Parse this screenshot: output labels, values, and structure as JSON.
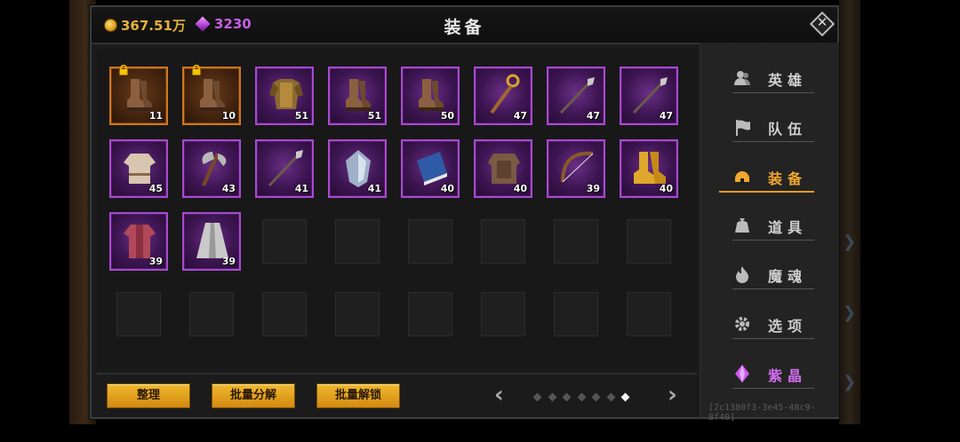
{
  "currency": {
    "gold": "367.51万",
    "gems": "3230"
  },
  "title": "装备",
  "inventory": [
    {
      "level": "11",
      "rarity": "orange",
      "locked": true,
      "icon": "boots-icon"
    },
    {
      "level": "10",
      "rarity": "orange",
      "locked": true,
      "icon": "boots-icon"
    },
    {
      "level": "51",
      "rarity": "purple",
      "locked": false,
      "icon": "armor-icon"
    },
    {
      "level": "51",
      "rarity": "purple",
      "locked": false,
      "icon": "boots-icon"
    },
    {
      "level": "50",
      "rarity": "purple",
      "locked": false,
      "icon": "boots-icon"
    },
    {
      "level": "47",
      "rarity": "purple",
      "locked": false,
      "icon": "staff-icon"
    },
    {
      "level": "47",
      "rarity": "purple",
      "locked": false,
      "icon": "spear-icon"
    },
    {
      "level": "47",
      "rarity": "purple",
      "locked": false,
      "icon": "spear-icon"
    },
    {
      "level": "45",
      "rarity": "purple",
      "locked": false,
      "icon": "tunic-icon"
    },
    {
      "level": "43",
      "rarity": "purple",
      "locked": false,
      "icon": "axe-icon"
    },
    {
      "level": "41",
      "rarity": "purple",
      "locked": false,
      "icon": "spear-icon"
    },
    {
      "level": "41",
      "rarity": "purple",
      "locked": false,
      "icon": "shield-icon"
    },
    {
      "level": "40",
      "rarity": "purple",
      "locked": false,
      "icon": "book-icon"
    },
    {
      "level": "40",
      "rarity": "purple",
      "locked": false,
      "icon": "leather-armor-icon"
    },
    {
      "level": "39",
      "rarity": "purple",
      "locked": false,
      "icon": "bow-icon"
    },
    {
      "level": "40",
      "rarity": "purple",
      "locked": false,
      "icon": "golden-boots-icon"
    },
    {
      "level": "39",
      "rarity": "purple",
      "locked": false,
      "icon": "robe-icon"
    },
    {
      "level": "39",
      "rarity": "purple",
      "locked": false,
      "icon": "cloak-icon"
    }
  ],
  "empty_slots": 14,
  "actions": {
    "sort": "整理",
    "batch_salvage": "批量分解",
    "batch_unlock": "批量解锁"
  },
  "pager": {
    "pages": 7,
    "current": 7,
    "prev": "‹",
    "next": "›"
  },
  "sidebar": [
    {
      "label": "英雄",
      "icon": "hero-icon"
    },
    {
      "label": "队伍",
      "icon": "flag-icon"
    },
    {
      "label": "装备",
      "icon": "helmet-icon",
      "active": true
    },
    {
      "label": "道具",
      "icon": "bag-icon"
    },
    {
      "label": "魔魂",
      "icon": "flame-icon"
    },
    {
      "label": "选项",
      "icon": "gear-icon"
    },
    {
      "label": "紫晶",
      "icon": "amethyst-icon",
      "purple": true
    }
  ],
  "footer_id": "[2c1380f3-3e45-48c9-8f40]",
  "colors": {
    "gold": "#e3b33a",
    "gem": "#c75ee6",
    "active_tab": "#f2a72e",
    "rare_border": "#a64ad2",
    "legendary_border": "#d0761c"
  }
}
